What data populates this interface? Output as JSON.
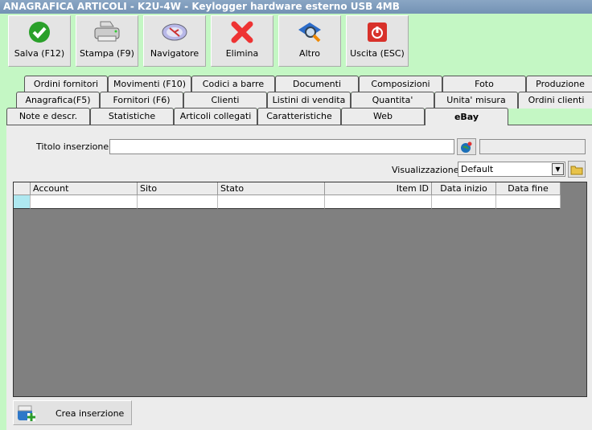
{
  "window": {
    "title": "ANAGRAFICA ARTICOLI - K2U-4W - Keylogger hardware esterno USB 4MB"
  },
  "toolbar": [
    {
      "label": "Salva (F12)",
      "icon": "check-icon"
    },
    {
      "label": "Stampa (F9)",
      "icon": "printer-icon"
    },
    {
      "label": "Navigatore",
      "icon": "compass-icon"
    },
    {
      "label": "Elimina",
      "icon": "delete-x-icon"
    },
    {
      "label": "Altro",
      "icon": "book-search-icon"
    },
    {
      "label": "Uscita (ESC)",
      "icon": "power-icon"
    }
  ],
  "tabs": {
    "row1": [
      "Ordini fornitori",
      "Movimenti (F10)",
      "Codici a barre",
      "Documenti",
      "Composizioni",
      "Foto",
      "Produzione"
    ],
    "row2": [
      "Anagrafica(F5)",
      "Fornitori (F6)",
      "Clienti",
      "Listini di vendita",
      "Quantita'",
      "Unita' misura",
      "Ordini clienti"
    ],
    "row3": [
      "Note e descr.",
      "Statistiche",
      "Articoli collegati",
      "Caratteristiche",
      "Web",
      "eBay"
    ],
    "selected": "eBay"
  },
  "form": {
    "title_label": "Titolo inserzione :",
    "title_value": "",
    "view_label": "Visualizzazione :",
    "view_value": "Default"
  },
  "grid": {
    "columns": [
      "Account",
      "Sito",
      "Stato",
      "Item ID",
      "Data inizio",
      "Data fine"
    ]
  },
  "actions": {
    "create_label": "Crea inserzione"
  }
}
